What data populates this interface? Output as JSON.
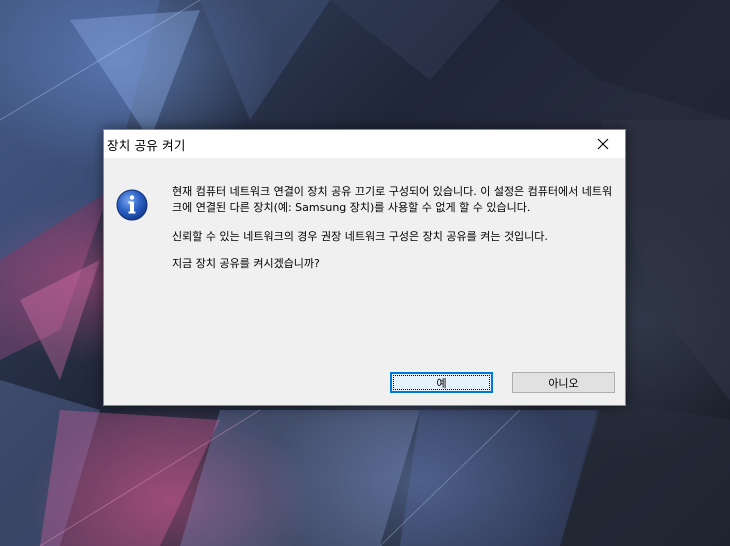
{
  "dialog": {
    "title": "장치 공유 켜기",
    "message_line1": "현재 컴퓨터 네트워크 연결이 장치 공유 끄기로 구성되어 있습니다. 이 설정은 컴퓨터에서 네트워크에 연결된 다른 장치(예: Samsung 장치)를 사용할 수 없게 할 수 있습니다.",
    "message_line2": "신뢰할 수 있는 네트워크의 경우 권장 네트워크 구성은 장치 공유를 켜는 것입니다.",
    "message_line3": "지금 장치 공유를 켜시겠습니까?",
    "yes_label": "예",
    "no_label": "아니오",
    "icon": "info-icon",
    "close_icon": "close-icon"
  },
  "colors": {
    "dialog_bg": "#f0f0f0",
    "titlebar_bg": "#ffffff",
    "accent": "#0078d7",
    "info_blue": "#1c4fb0"
  }
}
